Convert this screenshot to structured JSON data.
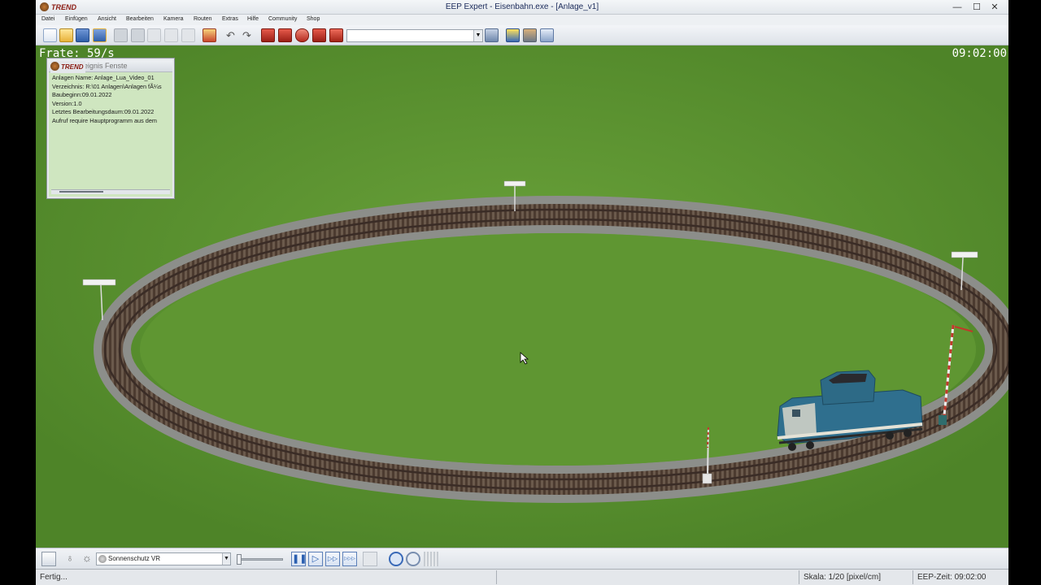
{
  "window": {
    "app_logo": "TREND",
    "title": "EEP Expert - Eisenbahn.exe - [Anlage_v1]",
    "minimize": "—",
    "maximize": "☐",
    "close": "✕"
  },
  "menu": [
    "Datei",
    "Einfügen",
    "Ansicht",
    "Bearbeiten",
    "Kamera",
    "Routen",
    "Extras",
    "Hilfe",
    "Community",
    "Shop"
  ],
  "toolbar": {
    "icons": [
      "new-file-icon",
      "open-folder-icon",
      "save-icon",
      "save-as-icon",
      "copy-icon",
      "paste-icon",
      "blank-icon",
      "blank-icon",
      "blank-icon",
      "export-icon",
      "undo-icon",
      "redo-icon",
      "train-list-icon",
      "train-list-icon",
      "loco-icon",
      "loco-icon",
      "signal-icon",
      "camera-icon",
      "sun-icon",
      "tools-icon",
      "info-icon"
    ],
    "combo_value": ""
  },
  "viewport": {
    "frame_rate": "Frate: 59/s",
    "clock": "09:02:00"
  },
  "event_window": {
    "logo": "TREND",
    "title": "Ereignis Fenste",
    "lines": [
      "Anlagen Name: Anlage_Lua_Video_01",
      "Verzeichnis: R:\\01 Anlagen\\Anlagen fÃ¼s",
      "Baubeginn:09.01.2022",
      "Version:1.0",
      "Letztes Bearbeitungsdaum:09.01.2022",
      "Aufruf require Hauptprogramm aus dem"
    ]
  },
  "bottombar": {
    "sun_select": "Sonnenschutz VR",
    "play_buttons": [
      "❚❚",
      "▷",
      "▷▷",
      "▷▷▷"
    ]
  },
  "status": {
    "left": "Fertig...",
    "scale": "Skala: 1/20 [pixel/cm]",
    "eep_time": "EEP-Zeit: 09:02:00"
  },
  "colors": {
    "grass": "#5e9434",
    "loco": "#2f6f8e",
    "rail": "#4a3a32"
  }
}
